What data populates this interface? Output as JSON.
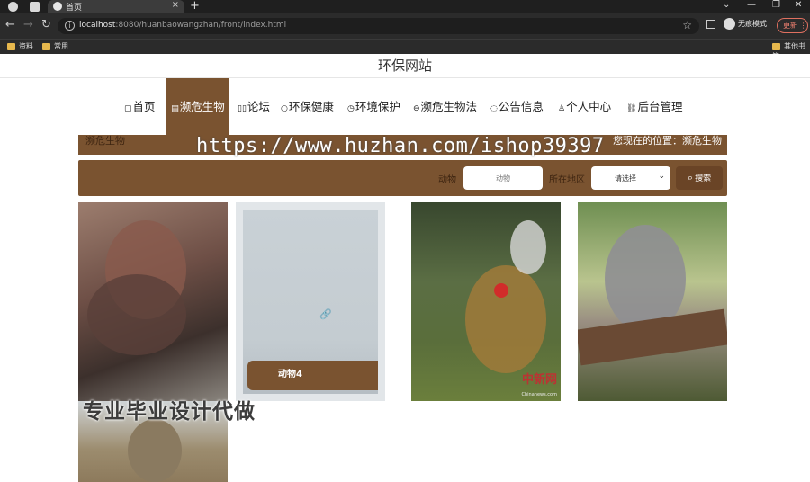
{
  "browser": {
    "tab_title": "首页",
    "url_host": "localhost",
    "url_rest": ":8080/huanbaowangzhan/front/index.html",
    "incognito_label": "无痕模式",
    "update_label": "更新",
    "bookmarks": [
      "资料",
      "常用"
    ],
    "bookmark_right": "其他书签"
  },
  "site": {
    "title": "环保网站"
  },
  "nav": {
    "items": [
      {
        "label": "首页",
        "icon": "home-icon"
      },
      {
        "label": "濒危生物",
        "icon": "list-icon"
      },
      {
        "label": "论坛",
        "icon": "forum-icon"
      },
      {
        "label": "环保健康",
        "icon": "health-icon"
      },
      {
        "label": "环境保护",
        "icon": "env-icon"
      },
      {
        "label": "濒危生物法",
        "icon": "law-icon"
      },
      {
        "label": "公告信息",
        "icon": "notice-icon"
      },
      {
        "label": "个人中心",
        "icon": "user-icon"
      },
      {
        "label": "后台管理",
        "icon": "link-icon"
      }
    ],
    "active_index": 1
  },
  "breadcrumb": {
    "left": "濒危生物",
    "right": "您现在的位置：濒危生物"
  },
  "watermark": "https://www.huzhan.com/ishop39397",
  "search": {
    "name_label": "动物",
    "name_placeholder": "动物",
    "region_label": "所在地区",
    "region_value": "请选择",
    "button_label": "搜索"
  },
  "cards": [
    {
      "name": "rhino"
    },
    {
      "name": "动物4"
    },
    {
      "name": "leopard",
      "source_mark": "中新网",
      "source_sub": "Chinanews.com"
    },
    {
      "name": "koala"
    },
    {
      "name": "wolf"
    }
  ],
  "banner": "专业毕业设计代做",
  "colors": {
    "brand_brown": "#7a5330",
    "button_brown": "#6a4426"
  }
}
